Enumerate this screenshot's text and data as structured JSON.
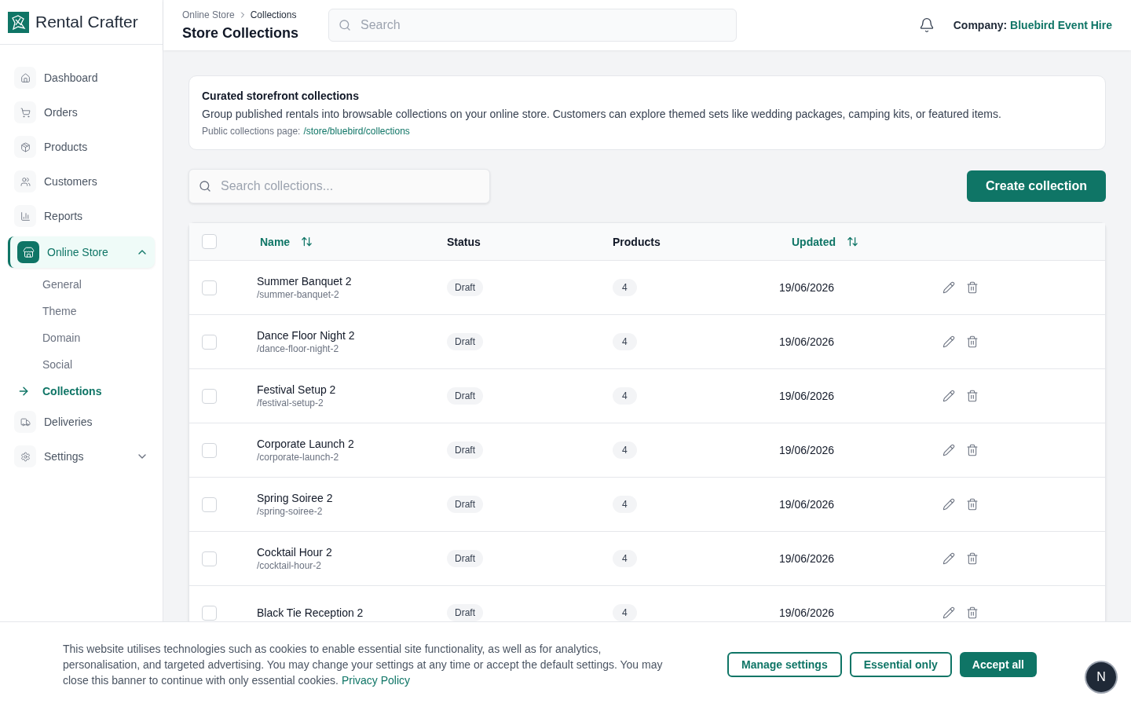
{
  "brand": {
    "name": "Rental Crafter"
  },
  "header": {
    "breadcrumb": [
      "Online Store",
      "Collections"
    ],
    "title": "Store Collections",
    "search": {
      "placeholder": "Search"
    },
    "company_label": "Company:",
    "company_name": "Bluebird Event Hire"
  },
  "sidebar": {
    "items": [
      {
        "label": "Dashboard",
        "selected": false
      },
      {
        "label": "Orders",
        "selected": false
      },
      {
        "label": "Products",
        "selected": false
      },
      {
        "label": "Customers",
        "selected": false
      },
      {
        "label": "Reports",
        "selected": false
      },
      {
        "label": "Online Store",
        "selected": true,
        "expanded": true,
        "children": [
          {
            "label": "General",
            "selected": false
          },
          {
            "label": "Theme",
            "selected": false
          },
          {
            "label": "Domain",
            "selected": false
          },
          {
            "label": "Social",
            "selected": false
          },
          {
            "label": "Collections",
            "selected": true
          }
        ]
      },
      {
        "label": "Deliveries",
        "selected": false
      },
      {
        "label": "Settings",
        "selected": false,
        "expanded": false
      }
    ]
  },
  "info_card": {
    "title": "Curated storefront collections",
    "text": "Group published rentals into browsable collections on your online store. Customers can explore themed sets like wedding packages, camping kits, or featured items.",
    "link_label": "Public collections page:",
    "link": "/store/bluebird/collections"
  },
  "toolbar": {
    "search": {
      "placeholder": "Search collections..."
    },
    "create_button": "Create collection"
  },
  "table": {
    "select_all": {
      "checked": false
    },
    "columns": [
      {
        "label": "Name",
        "sortable": true
      },
      {
        "label": "Status",
        "sortable": false
      },
      {
        "label": "Products",
        "sortable": false
      },
      {
        "label": "Updated",
        "sortable": true
      }
    ],
    "rows": [
      {
        "name": "Summer Banquet 2",
        "slug": "/summer-banquet-2",
        "status": "Draft",
        "products": "4",
        "updated": "19/06/2026",
        "checked": false
      },
      {
        "name": "Dance Floor Night 2",
        "slug": "/dance-floor-night-2",
        "status": "Draft",
        "products": "4",
        "updated": "19/06/2026",
        "checked": false
      },
      {
        "name": "Festival Setup 2",
        "slug": "/festival-setup-2",
        "status": "Draft",
        "products": "4",
        "updated": "19/06/2026",
        "checked": false
      },
      {
        "name": "Corporate Launch 2",
        "slug": "/corporate-launch-2",
        "status": "Draft",
        "products": "4",
        "updated": "19/06/2026",
        "checked": false
      },
      {
        "name": "Spring Soiree 2",
        "slug": "/spring-soiree-2",
        "status": "Draft",
        "products": "4",
        "updated": "19/06/2026",
        "checked": false
      },
      {
        "name": "Cocktail Hour 2",
        "slug": "/cocktail-hour-2",
        "status": "Draft",
        "products": "4",
        "updated": "19/06/2026",
        "checked": false
      },
      {
        "name": "Black Tie Reception 2",
        "status": "Draft",
        "products": "4",
        "updated": "19/06/2026",
        "checked": false
      }
    ]
  },
  "cookie_banner": {
    "text": "This website utilises technologies such as cookies to enable essential site functionality, as well as for analytics, personalisation, and targeted advertising. You may change your settings at any time or accept the default settings. You may close this banner to continue with only essential cookies.",
    "link": "Privacy Policy",
    "buttons": [
      {
        "label": "Manage settings",
        "kind": "outline"
      },
      {
        "label": "Essential only",
        "kind": "outline"
      },
      {
        "label": "Accept all",
        "kind": "primary"
      }
    ],
    "avatar_letter": "N"
  }
}
